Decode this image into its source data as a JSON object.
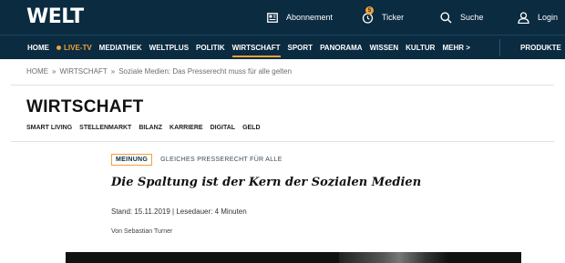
{
  "header": {
    "logo": "WELT",
    "tools": {
      "abonnement": "Abonnement",
      "ticker": "Ticker",
      "ticker_badge": "5",
      "suche": "Suche",
      "login": "Login"
    }
  },
  "nav": {
    "items": [
      "HOME",
      "LIVE-TV",
      "MEDIATHEK",
      "WELTPLUS",
      "POLITIK",
      "WIRTSCHAFT",
      "SPORT",
      "PANORAMA",
      "WISSEN",
      "KULTUR",
      "MEHR >"
    ],
    "active": "WIRTSCHAFT",
    "produkte": "PRODUKTE"
  },
  "breadcrumb": {
    "home": "HOME",
    "section": "WIRTSCHAFT",
    "article": "Soziale Medien: Das Presserecht muss für alle gelten",
    "separator": "»"
  },
  "section": {
    "title": "WIRTSCHAFT",
    "subnav": [
      "SMART LIVING",
      "STELLENMARKT",
      "BILANZ",
      "KARRIERE",
      "DIGITAL",
      "GELD"
    ]
  },
  "article": {
    "kicker": "MEINUNG",
    "topic": "GLEICHES PRESSERECHT FÜR ALLE",
    "headline": "Die Spaltung ist der Kern der Sozialen Medien",
    "meta": "Stand: 15.11.2019 | Lesedauer: 4 Minuten",
    "author": "Von Sebastian Turner"
  },
  "colors": {
    "brand_navy": "#0a2b40",
    "accent": "#f0a23b"
  },
  "icons": {
    "abonnement": "newspaper-icon",
    "ticker": "alarm-clock-icon",
    "suche": "search-icon",
    "login": "user-icon"
  }
}
